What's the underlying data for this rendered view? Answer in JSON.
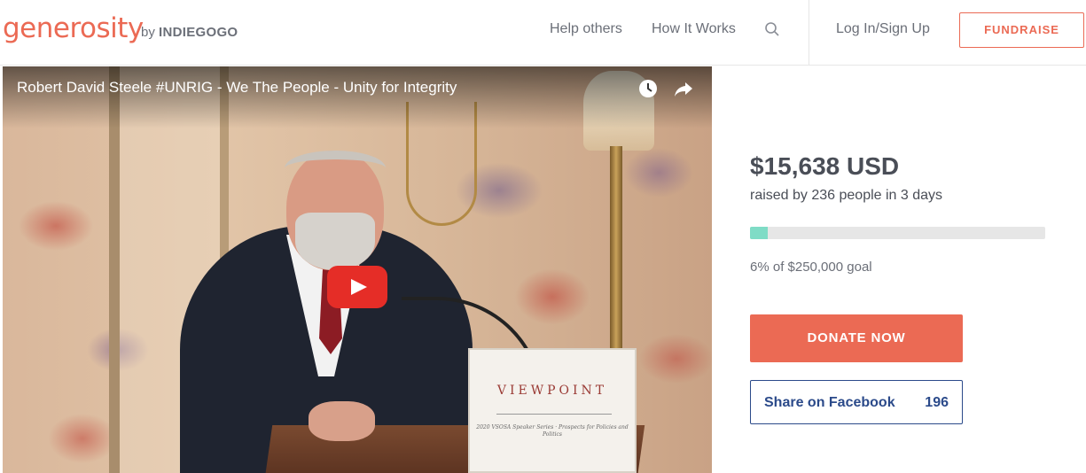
{
  "header": {
    "logo": "generosity",
    "by_prefix": "by",
    "by_brand": "INDIEGOGO",
    "nav": [
      "Help others",
      "How It Works"
    ],
    "search_icon": "search-icon",
    "login": "Log In/Sign Up",
    "fundraise": "FUNDRAISE"
  },
  "video": {
    "title": "Robert David Steele #UNRIG - We The People - Unity for Integrity",
    "podium_text": "VIEWPOINT",
    "podium_small": "2020 VSOSA Speaker Series · Prospects for Policies and Politics",
    "icons": [
      "clock-icon",
      "share-icon",
      "play-icon"
    ]
  },
  "campaign": {
    "amount": "$15,638 USD",
    "raised_text": "raised by 236 people in 3 days",
    "progress_percent": 6,
    "goal_text": "6% of $250,000 goal",
    "donate_label": "DONATE NOW",
    "share_label": "Share on Facebook",
    "share_count": "196"
  },
  "colors": {
    "brand": "#eb6a54",
    "progress": "#7fdcc6",
    "facebook": "#2b4a8a"
  }
}
